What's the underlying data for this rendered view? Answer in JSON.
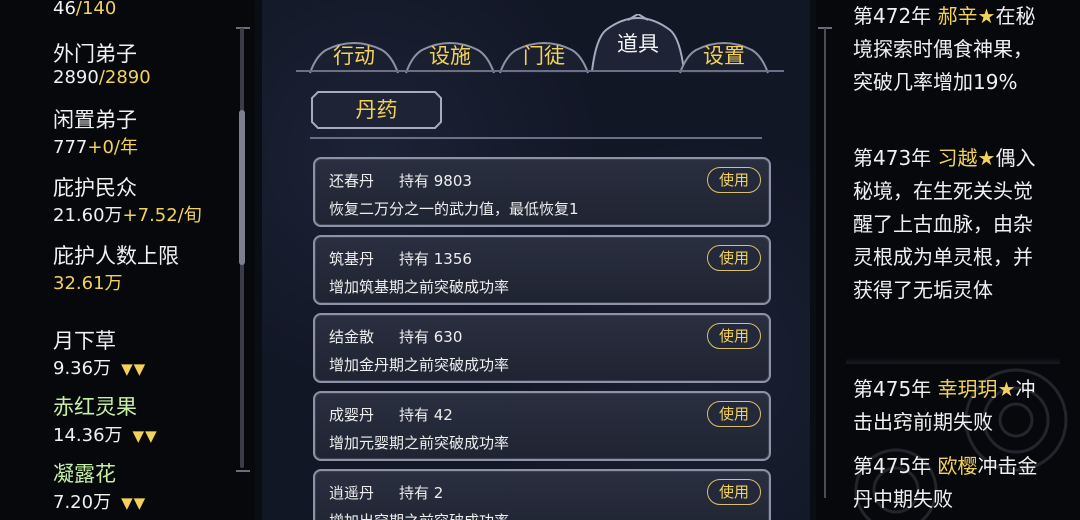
{
  "left": {
    "top_value": {
      "current": "46",
      "max": "/140"
    },
    "outer_disciples": {
      "label": "外门弟子",
      "current": "2890",
      "max": "/2890"
    },
    "idle_disciples": {
      "label": "闲置弟子",
      "current": "777",
      "rate": "+0/年"
    },
    "protected_people": {
      "label": "庇护民众",
      "current": "21.60万",
      "rate": "+7.52/旬"
    },
    "protect_limit": {
      "label": "庇护人数上限",
      "value": "32.61万"
    },
    "herbs": [
      {
        "name": "月下草",
        "amount": "9.36万",
        "trend": "▼▼",
        "color": "#f0f0f0"
      },
      {
        "name": "赤红灵果",
        "amount": "14.36万",
        "trend": "▼▼",
        "color": "#c6f0a6"
      },
      {
        "name": "凝露花",
        "amount": "7.20万",
        "trend": "▼▼",
        "color": "#c6f0a6"
      }
    ]
  },
  "tabs": [
    {
      "label": "行动",
      "active": false
    },
    {
      "label": "设施",
      "active": false
    },
    {
      "label": "门徒",
      "active": false
    },
    {
      "label": "道具",
      "active": true
    },
    {
      "label": "设置",
      "active": false
    }
  ],
  "subtab": {
    "label": "丹药"
  },
  "items": [
    {
      "name": "还春丹",
      "hold": "持有 9803",
      "desc": "恢复二万分之一的武力值，最低恢复1",
      "button": "使用"
    },
    {
      "name": "筑基丹",
      "hold": "持有 1356",
      "desc": "增加筑基期之前突破成功率",
      "button": "使用"
    },
    {
      "name": "结金散",
      "hold": "持有 630",
      "desc": "增加金丹期之前突破成功率",
      "button": "使用"
    },
    {
      "name": "成婴丹",
      "hold": "持有 42",
      "desc": "增加元婴期之前突破成功率",
      "button": "使用"
    },
    {
      "name": "逍遥丹",
      "hold": "持有 2",
      "desc": "增加出窍期之前突破成功率",
      "button": "使用"
    }
  ],
  "log": [
    {
      "year": "第472年 ",
      "who": "郝辛★",
      "text": "在秘境探索时偶食神果，突破几率增加19%"
    },
    {
      "year": "第473年 ",
      "who": "习越★",
      "text": "偶入秘境，在生死关头觉醒了上古血脉，由杂灵根成为单灵根，并获得了无垢灵体"
    },
    {
      "year": "第475年 ",
      "who": "幸玥玥★",
      "text": "冲击出窍前期失败"
    },
    {
      "year": "第475年 ",
      "who": "欧樱",
      "text": "冲击金丹中期失败"
    }
  ]
}
